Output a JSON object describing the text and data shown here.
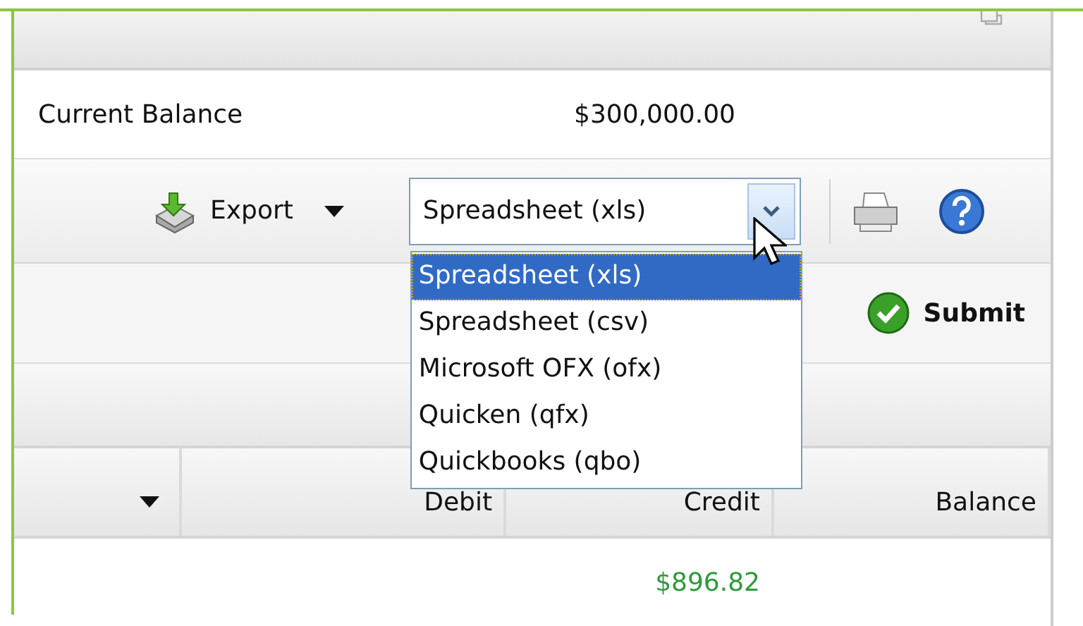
{
  "balance": {
    "label": "Current Balance",
    "amount": "$300,000.00"
  },
  "toolbar": {
    "export_label": "Export",
    "format_select": {
      "value": "Spreadsheet (xls)",
      "expanded": true,
      "options": [
        {
          "label": "Spreadsheet (xls)",
          "selected": true
        },
        {
          "label": "Spreadsheet (csv)",
          "selected": false
        },
        {
          "label": "Microsoft OFX (ofx)",
          "selected": false
        },
        {
          "label": "Quicken (qfx)",
          "selected": false
        },
        {
          "label": "Quickbooks (qbo)",
          "selected": false
        }
      ]
    }
  },
  "submit": {
    "label": "Submit"
  },
  "table": {
    "columns": [
      "Debit",
      "Credit",
      "Balance"
    ],
    "rows": [
      {
        "debit": null,
        "credit": "$896.82",
        "balance": null
      }
    ]
  }
}
